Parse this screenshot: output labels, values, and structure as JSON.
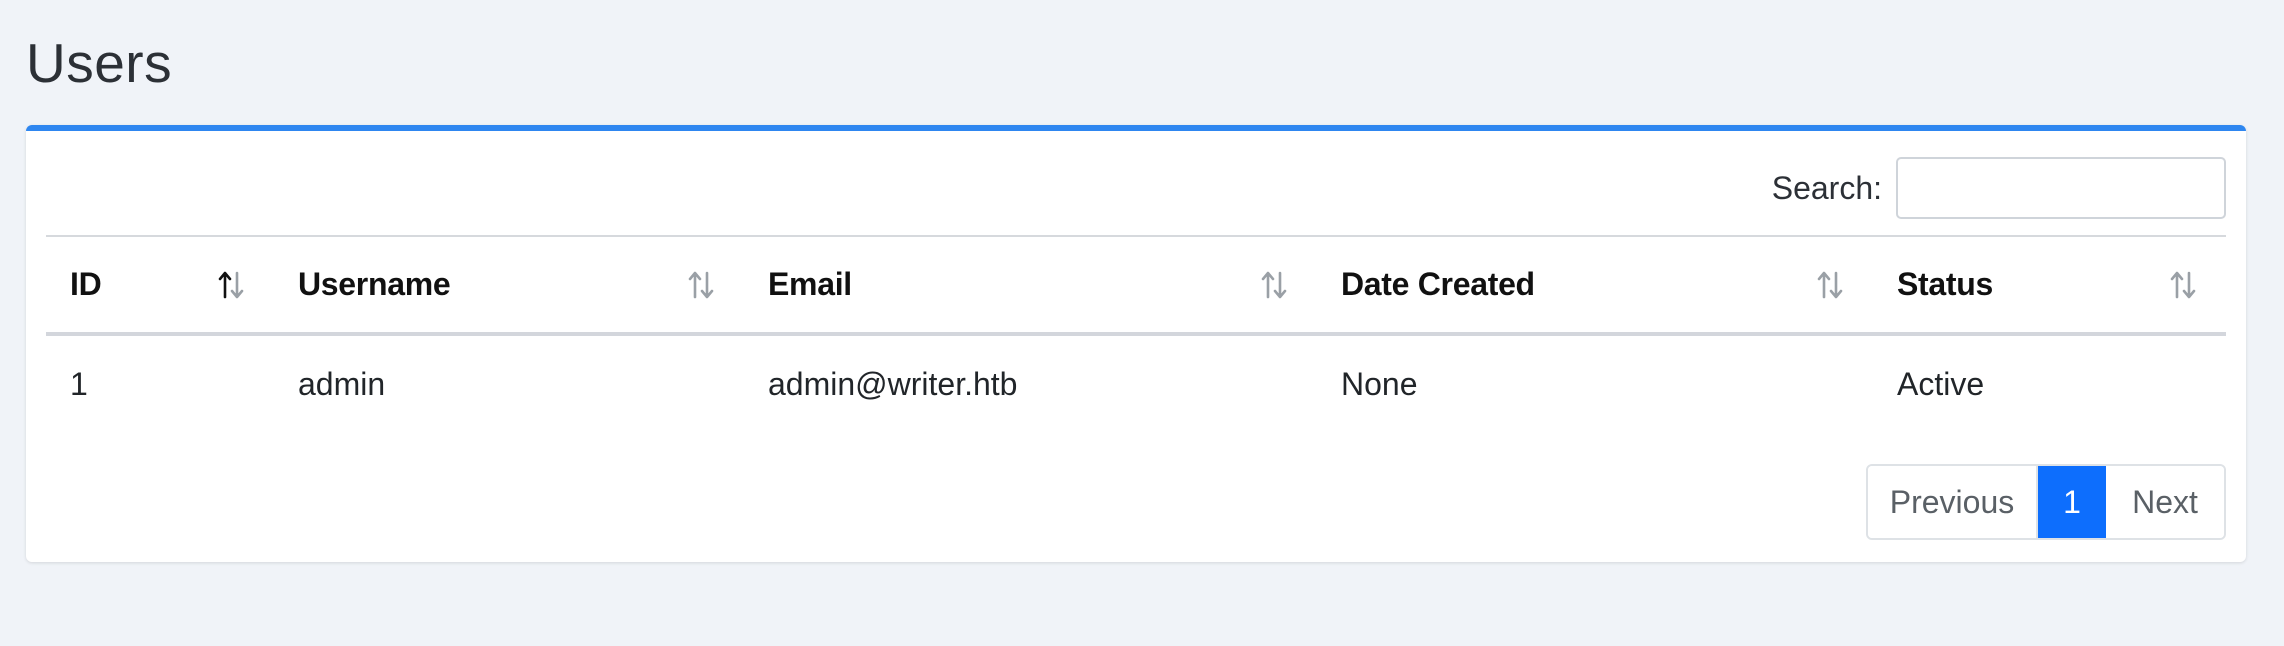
{
  "page": {
    "title": "Users"
  },
  "search": {
    "label": "Search:",
    "value": "",
    "placeholder": ""
  },
  "table": {
    "columns": [
      {
        "label": "ID",
        "sort": "asc"
      },
      {
        "label": "Username",
        "sort": "none"
      },
      {
        "label": "Email",
        "sort": "none"
      },
      {
        "label": "Date Created",
        "sort": "none"
      },
      {
        "label": "Status",
        "sort": "none"
      }
    ],
    "rows": [
      {
        "id": "1",
        "username": "admin",
        "email": "admin@writer.htb",
        "date_created": "None",
        "status": "Active"
      }
    ]
  },
  "pagination": {
    "previous_label": "Previous",
    "current_page": "1",
    "next_label": "Next"
  },
  "colors": {
    "accent": "#2e86f0",
    "active_page": "#0d6efd",
    "background": "#f0f3f8"
  },
  "icons": {
    "sort": "sort-arrows-icon"
  }
}
